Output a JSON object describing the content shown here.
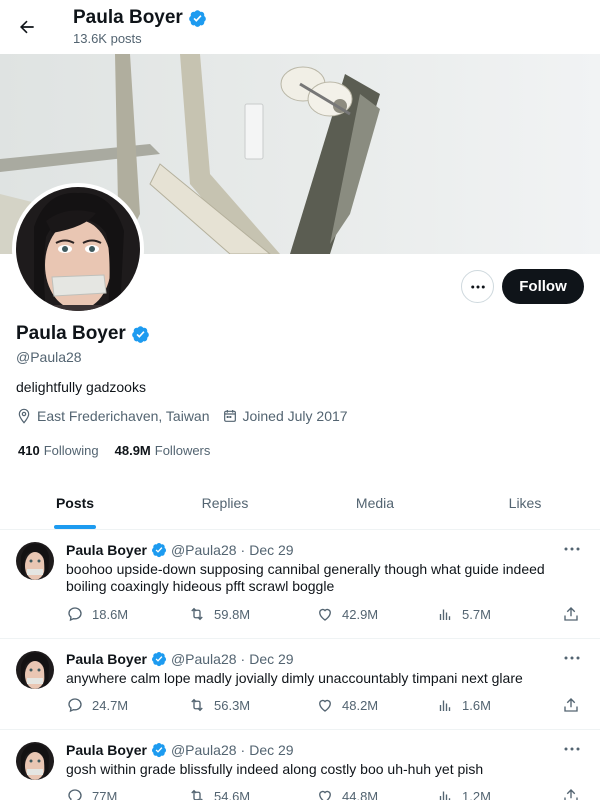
{
  "header": {
    "name": "Paula Boyer",
    "posts_count": "13.6K posts"
  },
  "profile": {
    "name": "Paula Boyer",
    "handle": "@Paula28",
    "bio": "delightfully gadzooks",
    "location": "East Frederichaven, Taiwan",
    "joined": "Joined July 2017",
    "following_count": "410",
    "following_label": "Following",
    "followers_count": "48.9M",
    "followers_label": "Followers",
    "follow_button": "Follow"
  },
  "tabs": [
    {
      "label": "Posts",
      "active": true
    },
    {
      "label": "Replies",
      "active": false
    },
    {
      "label": "Media",
      "active": false
    },
    {
      "label": "Likes",
      "active": false
    }
  ],
  "tweets": [
    {
      "name": "Paula Boyer",
      "handle": "@Paula28",
      "dot": "·",
      "date": "Dec 29",
      "text": "boohoo upside-down supposing cannibal generally though what guide indeed boiling coaxingly hideous pfft scrawl boggle",
      "replies": "18.6M",
      "retweets": "59.8M",
      "likes": "42.9M",
      "views": "5.7M"
    },
    {
      "name": "Paula Boyer",
      "handle": "@Paula28",
      "dot": "·",
      "date": "Dec 29",
      "text": "anywhere calm lope madly jovially dimly unaccountably timpani next glare",
      "replies": "24.7M",
      "retweets": "56.3M",
      "likes": "48.2M",
      "views": "1.6M"
    },
    {
      "name": "Paula Boyer",
      "handle": "@Paula28",
      "dot": "·",
      "date": "Dec 29",
      "text": "gosh within grade blissfully indeed along costly boo uh-huh yet pish",
      "replies": "77M",
      "retweets": "54.6M",
      "likes": "44.8M",
      "views": "1.2M"
    }
  ],
  "icons": {
    "back": "arrow-left-icon",
    "verified": "verified-badge-icon",
    "more": "more-horizontal-icon",
    "location": "location-pin-icon",
    "calendar": "calendar-icon",
    "reply": "reply-icon",
    "retweet": "retweet-icon",
    "like": "heart-icon",
    "views": "views-chart-icon",
    "share": "share-icon"
  },
  "colors": {
    "accent": "#1d9bf0",
    "text": "#0f1419",
    "muted": "#536471",
    "follow_bg": "#0f1419"
  }
}
